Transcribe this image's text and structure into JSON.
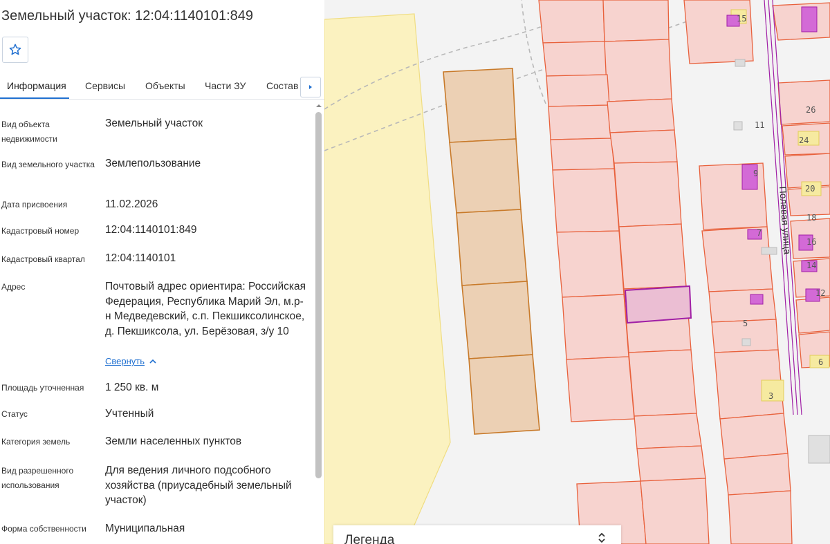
{
  "title": "Земельный участок: 12:04:1140101:849",
  "tabs": [
    {
      "label": "Информация"
    },
    {
      "label": "Сервисы"
    },
    {
      "label": "Объекты"
    },
    {
      "label": "Части ЗУ"
    },
    {
      "label": "Состав"
    }
  ],
  "info": {
    "kind_label": "Вид объекта недвижимости",
    "kind_value": "Земельный участок",
    "parcel_type_label": "Вид земельного участка",
    "parcel_type_value": "Землепользование",
    "date_label": "Дата присвоения",
    "date_value": "11.02.2026",
    "cad_number_label": "Кадастровый номер",
    "cad_number_value": "12:04:1140101:849",
    "cad_quarter_label": "Кадастровый квартал",
    "cad_quarter_value": "12:04:1140101",
    "address_label": "Адрес",
    "address_value": "Почтовый адрес ориентира: Российская Федерация, Республика Марий Эл, м.р-н Медведевский, с.п. Пекшиксолинское, д. Пекшиксола, ул. Берёзовая, з/у 10",
    "collapse_link": "Свернуть",
    "area_label": "Площадь уточненная",
    "area_value": "1 250 кв. м",
    "status_label": "Статус",
    "status_value": "Учтенный",
    "category_label": "Категория земель",
    "category_value": "Земли населенных пунктов",
    "usage_label": "Вид разрешенного использования",
    "usage_value": "Для ведения личного подсобного хозяйства (приусадебный земельный участок)",
    "ownership_label": "Форма собственности",
    "ownership_value": "Муниципальная"
  },
  "map": {
    "street_label": "Полевая улица",
    "house_numbers": [
      "15",
      "26",
      "11",
      "24",
      "9",
      "20",
      "18",
      "7",
      "16",
      "14",
      "12",
      "5",
      "6",
      "3"
    ]
  },
  "legend": {
    "title": "Легенда"
  },
  "icons": {
    "favorite": "star-outline-icon",
    "tabs_scroll": "chevron-right-icon",
    "collapse": "chevron-up-icon",
    "legend_toggle": "chevron-up-down-icon"
  },
  "colors": {
    "accent": "#1f6fd0",
    "parcel_stroke": "#e8613c",
    "parcel_fill": "#f7d3cf",
    "selected_parcel": "#a01fa6",
    "field_fill": "#fbf2c0",
    "brown_parcel": "#c87a2a"
  }
}
